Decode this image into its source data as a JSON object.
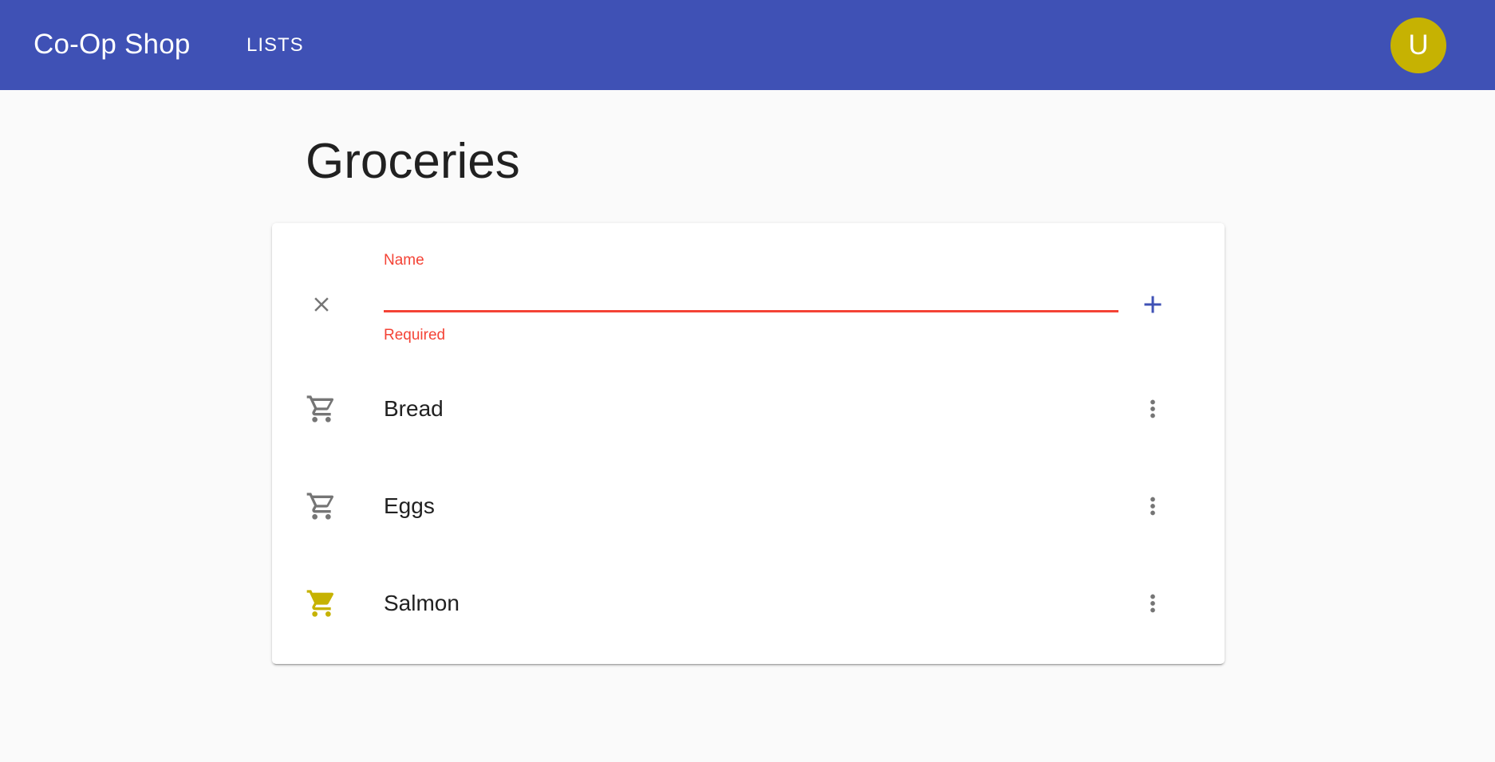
{
  "app": {
    "title": "Co-Op Shop",
    "nav_lists": "LISTS",
    "avatar_initial": "U",
    "colors": {
      "primary": "#3f51b5",
      "accent": "#c6b202",
      "error": "#f44336",
      "icon": "#757575"
    }
  },
  "page": {
    "title": "Groceries"
  },
  "new_item_form": {
    "label": "Name",
    "value": "",
    "error": "Required",
    "cancel_icon": "close-icon",
    "add_icon": "add-icon"
  },
  "items": [
    {
      "label": "Bread",
      "icon": "cart-outline-icon",
      "in_cart": false,
      "menu_icon": "more-vert-icon"
    },
    {
      "label": "Eggs",
      "icon": "cart-outline-icon",
      "in_cart": false,
      "menu_icon": "more-vert-icon"
    },
    {
      "label": "Salmon",
      "icon": "cart-filled-icon",
      "in_cart": true,
      "menu_icon": "more-vert-icon"
    }
  ]
}
